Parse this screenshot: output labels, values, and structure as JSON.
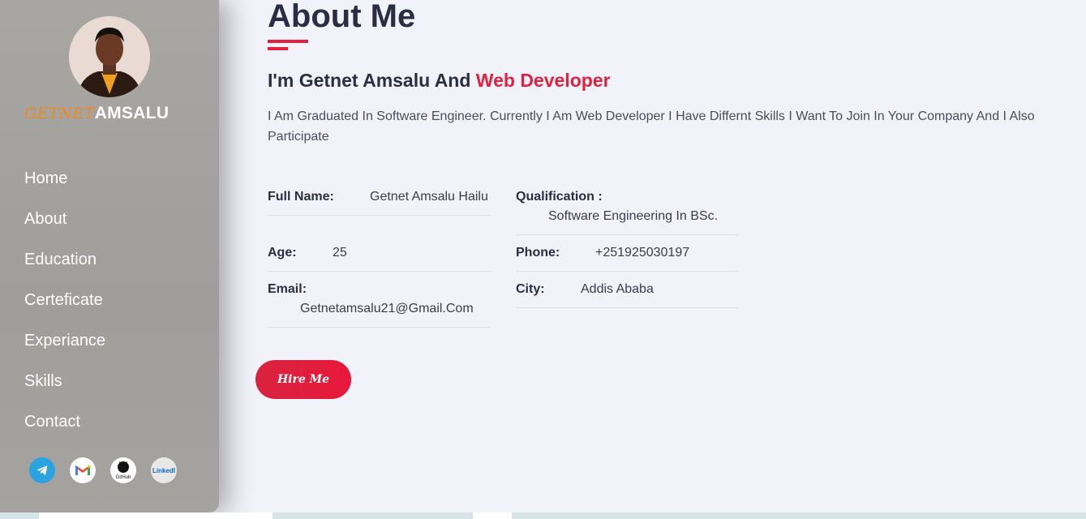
{
  "sidebar": {
    "brand_first": "GETNET",
    "brand_last": "AMSALU",
    "nav": [
      {
        "label": "Home"
      },
      {
        "label": "About"
      },
      {
        "label": "Education"
      },
      {
        "label": "Certeficate"
      },
      {
        "label": "Experiance"
      },
      {
        "label": "Skills"
      },
      {
        "label": "Contact"
      }
    ],
    "social": [
      {
        "icon": "telegram-icon",
        "color": "#2aa3e0"
      },
      {
        "icon": "gmail-icon",
        "color": "#ea4335"
      },
      {
        "icon": "github-icon",
        "label": "GitHub",
        "color": "#000000"
      },
      {
        "icon": "linkedin-icon",
        "label": "LinkedIn",
        "color": "#0a66c2"
      }
    ]
  },
  "main": {
    "title": "About Me",
    "subtitle_prefix": "I'm Getnet Amsalu And ",
    "subtitle_accent": "Web Developer",
    "description": "I Am Graduated In Software Engineer. Currently I Am Web Developer I Have Differnt Skills I Want To Join In Your Company And I Also Participate",
    "info": {
      "full_name_label": "Full Name:",
      "full_name_value": "Getnet Amsalu Hailu",
      "qualification_label": "Qualification :",
      "qualification_value": "Software Engineering In BSc.",
      "age_label": "Age:",
      "age_value": "25",
      "phone_label": "Phone:",
      "phone_value": "+251925030197",
      "email_label": "Email:",
      "email_value": "Getnetamsalu21@Gmail.Com",
      "city_label": "City:",
      "city_value": "Addis Ababa"
    },
    "hire_label": "Hire Me"
  },
  "colors": {
    "accent": "#e0223e",
    "brand_orange": "#f08a1c",
    "sidebar_bg": "#a3a19e",
    "page_bg": "#f2f3fa"
  }
}
